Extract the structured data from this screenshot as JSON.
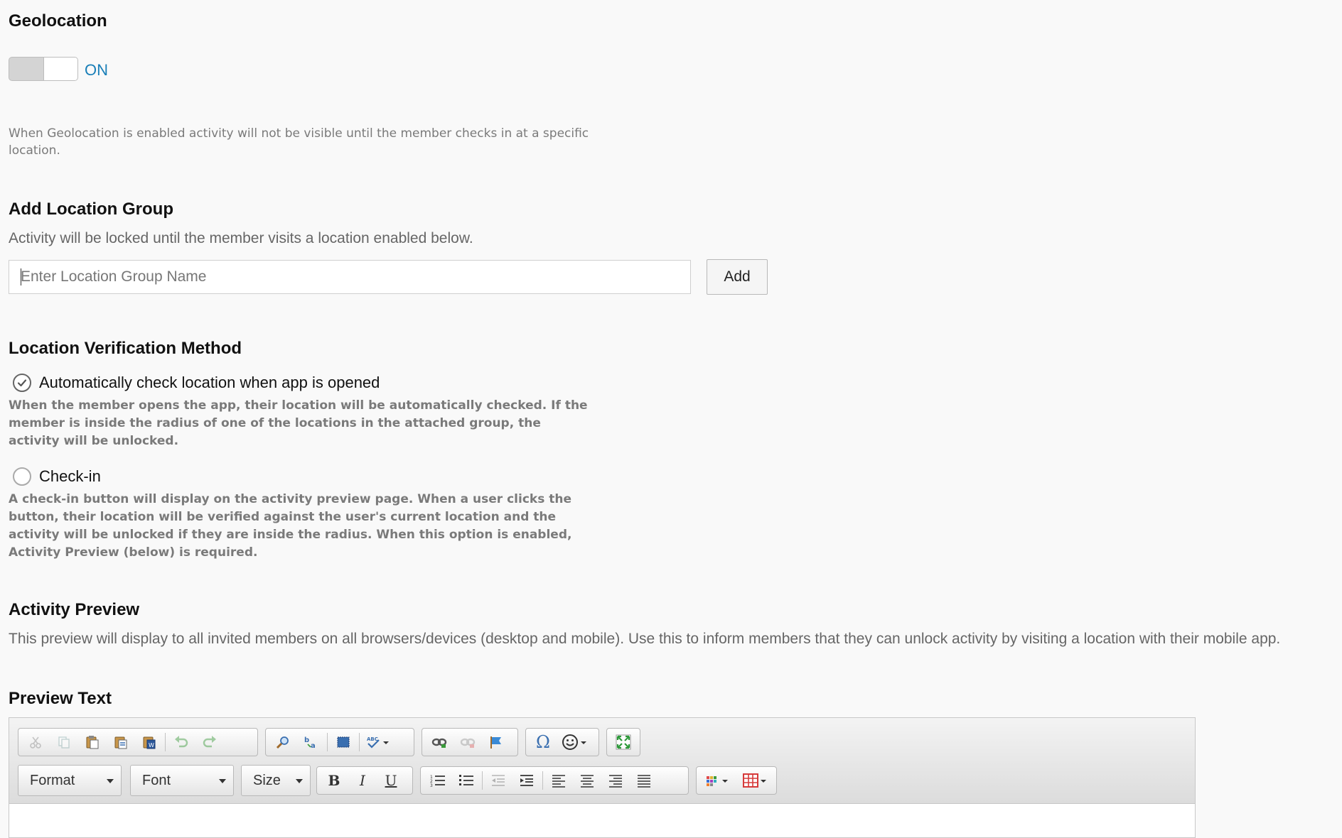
{
  "geolocation": {
    "title": "Geolocation",
    "toggle_state": "ON",
    "description": "When Geolocation is enabled activity will not be visible until the member checks in at a specific location."
  },
  "location_group": {
    "title": "Add Location Group",
    "description": "Activity will be locked until the member visits a location enabled below.",
    "input_placeholder": "Enter Location Group Name",
    "input_value": "",
    "add_label": "Add"
  },
  "verification": {
    "title": "Location Verification Method",
    "options": [
      {
        "label": "Automatically check location when app is opened",
        "checked": true,
        "description": "When the member opens the app, their location will be automatically checked. If the member is inside the radius of one of the locations in the attached group, the activity will be unlocked."
      },
      {
        "label": "Check-in",
        "checked": false,
        "description": "A check-in button will display on the activity preview page. When a user clicks the button, their location will be verified against the user's current location and the activity will be unlocked if they are inside the radius. When this option is enabled, Activity Preview (below) is required."
      }
    ]
  },
  "activity_preview": {
    "title": "Activity Preview",
    "description": "This preview will display to all invited members on all browsers/devices (desktop and mobile). Use this to inform members that they can unlock activity by visiting a location with their mobile app."
  },
  "preview_text": {
    "title": "Preview Text",
    "toolbar": {
      "format_label": "Format",
      "font_label": "Font",
      "size_label": "Size",
      "bold_glyph": "B",
      "italic_glyph": "I",
      "underline_glyph": "U",
      "omega_glyph": "Ω"
    }
  },
  "colors": {
    "accent": "#1a7fb8",
    "muted_text": "#7a7a7a",
    "background": "#f9f9f9"
  }
}
